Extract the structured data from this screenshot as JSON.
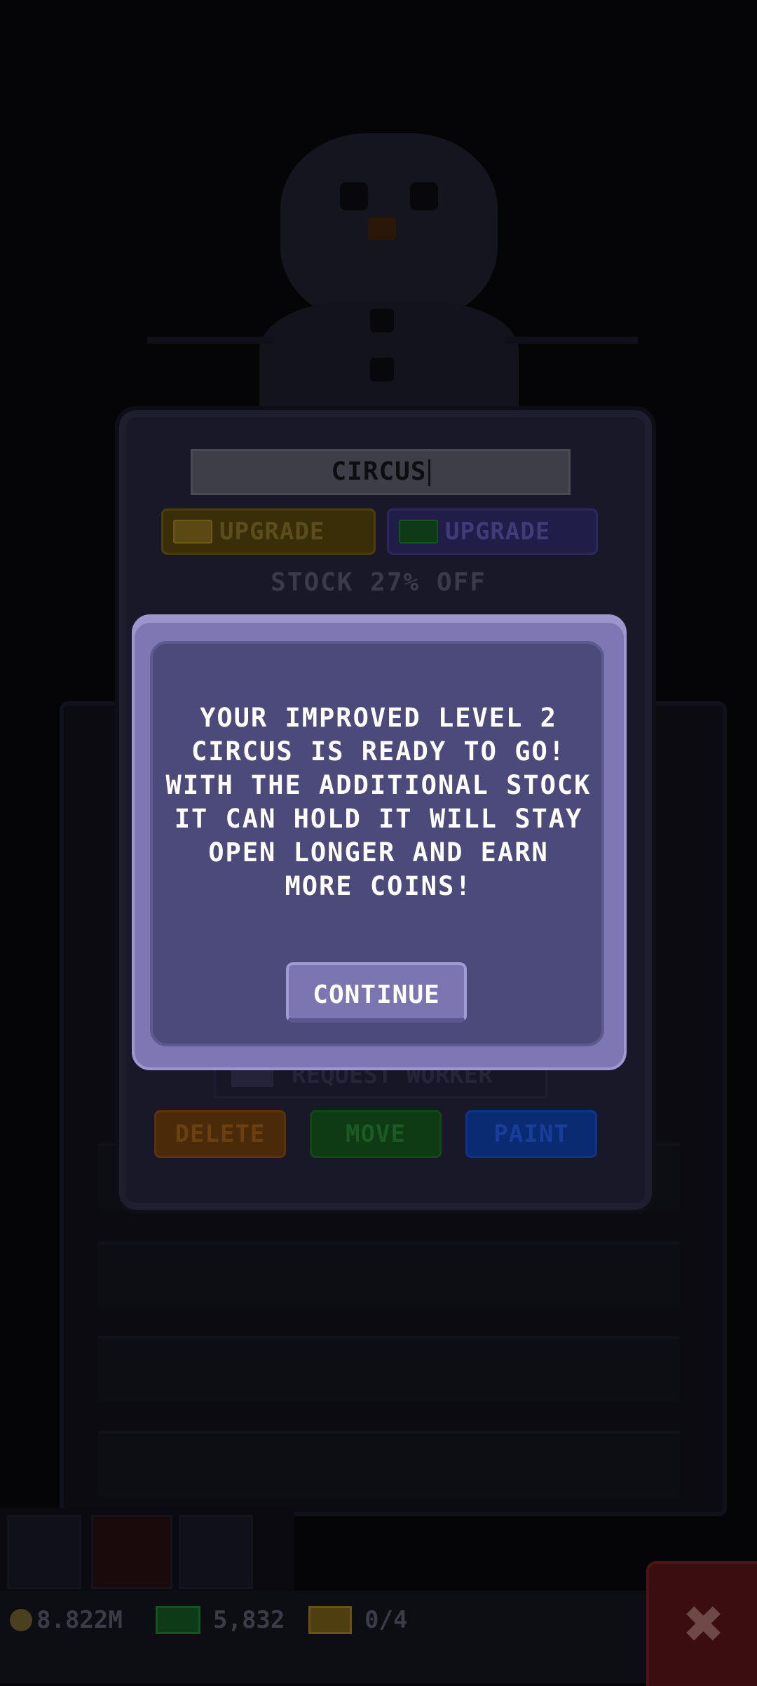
{
  "building": {
    "name": "CIRCUS",
    "upgrade_coins_label": "UPGRADE",
    "upgrade_bux_label": "UPGRADE",
    "stock_discount": "STOCK 27% OFF",
    "request_worker_label": "REQUEST WORKER",
    "delete_label": "DELETE",
    "move_label": "MOVE",
    "paint_label": "PAINT"
  },
  "popup": {
    "lines": [
      "YOUR IMPROVED LEVEL 2",
      "CIRCUS IS READY TO GO!",
      "WITH THE ADDITIONAL STOCK",
      "IT CAN HOLD IT WILL STAY",
      "OPEN LONGER AND EARN",
      "MORE COINS!"
    ],
    "continue_label": "CONTINUE"
  },
  "status_bar": {
    "coins": "8.822M",
    "bux": "5,832",
    "gold_tickets": "0/4"
  },
  "colors": {
    "popup_fill": "#4c4a7a",
    "popup_border": "#7f77b4",
    "continue_button": "#7b75b2"
  }
}
